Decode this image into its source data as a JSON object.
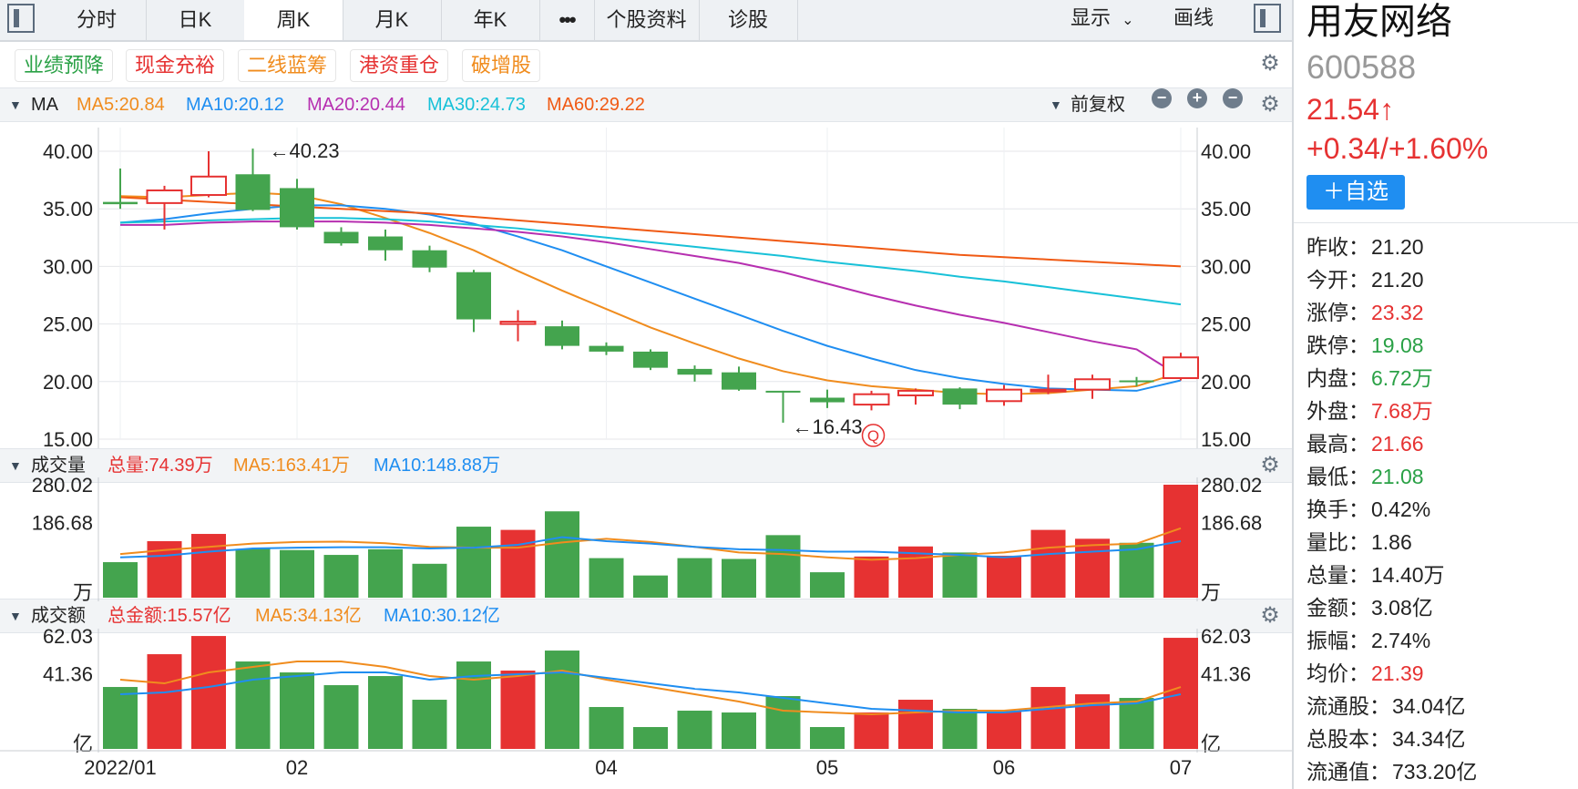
{
  "toolbar": {
    "tabs": [
      "分时",
      "日K",
      "周K",
      "月K",
      "年K",
      "•••",
      "个股资料",
      "诊股"
    ],
    "active_tab": "周K",
    "display_label": "显示",
    "draw_label": "画线"
  },
  "tags": [
    {
      "label": "业绩预降",
      "color": "#2aa146"
    },
    {
      "label": "现金充裕",
      "color": "#e63232"
    },
    {
      "label": "二线蓝筹",
      "color": "#f08c1e"
    },
    {
      "label": "港资重仓",
      "color": "#e63232"
    },
    {
      "label": "破增股",
      "color": "#f08c1e"
    }
  ],
  "ma_bar": {
    "label": "MA",
    "items": [
      {
        "text": "MA5:20.84",
        "color": "#f08c1e"
      },
      {
        "text": "MA10:20.12",
        "color": "#1f8ef1"
      },
      {
        "text": "MA20:20.44",
        "color": "#b62fb0"
      },
      {
        "text": "MA30:24.73",
        "color": "#18c1d8"
      },
      {
        "text": "MA60:29.22",
        "color": "#f05a14"
      }
    ],
    "adjust_label": "前复权"
  },
  "volume_bar": {
    "label": "成交量",
    "items": [
      {
        "text": "总量:74.39万",
        "color": "#e63232"
      },
      {
        "text": "MA5:163.41万",
        "color": "#f08c1e"
      },
      {
        "text": "MA10:148.88万",
        "color": "#1f8ef1"
      }
    ]
  },
  "amount_bar": {
    "label": "成交额",
    "items": [
      {
        "text": "总金额:15.57亿",
        "color": "#e63232"
      },
      {
        "text": "MA5:34.13亿",
        "color": "#f08c1e"
      },
      {
        "text": "MA10:30.12亿",
        "color": "#1f8ef1"
      }
    ]
  },
  "quote": {
    "name": "用友网络",
    "code": "600588",
    "price": "21.54↑",
    "change": "+0.34/+1.60%",
    "add_button": "＋自选",
    "rows": [
      {
        "label": "昨收：",
        "value": "21.20",
        "color": "black"
      },
      {
        "label": "今开：",
        "value": "21.20",
        "color": "black"
      },
      {
        "label": "涨停：",
        "value": "23.32",
        "color": "red"
      },
      {
        "label": "跌停：",
        "value": "19.08",
        "color": "green"
      },
      {
        "label": "内盘：",
        "value": "6.72万",
        "color": "green"
      },
      {
        "label": "外盘：",
        "value": "7.68万",
        "color": "red"
      },
      {
        "label": "最高：",
        "value": "21.66",
        "color": "red"
      },
      {
        "label": "最低：",
        "value": "21.08",
        "color": "green"
      },
      {
        "label": "换手：",
        "value": "0.42%",
        "color": "black"
      },
      {
        "label": "量比：",
        "value": "1.86",
        "color": "black"
      },
      {
        "label": "总量：",
        "value": "14.40万",
        "color": "black"
      },
      {
        "label": "金额：",
        "value": "3.08亿",
        "color": "black"
      },
      {
        "label": "振幅：",
        "value": "2.74%",
        "color": "black"
      },
      {
        "label": "均价：",
        "value": "21.39",
        "color": "red"
      },
      {
        "label": "流通股：",
        "value": "34.04亿",
        "color": "black"
      },
      {
        "label": "总股本：",
        "value": "34.34亿",
        "color": "black"
      },
      {
        "label": "流通值：",
        "value": "733.20亿",
        "color": "black"
      }
    ]
  },
  "chart_data": {
    "type": "candlestick",
    "price_axis": {
      "ticks": [
        "40.00",
        "35.00",
        "30.00",
        "25.00",
        "20.00",
        "15.00"
      ],
      "ylim": [
        15,
        40
      ]
    },
    "x_tick_labels": [
      "2022/01",
      "02",
      "04",
      "05",
      "06",
      "07"
    ],
    "annotations": {
      "high_label": "←40.23",
      "low_label": "←16.43",
      "marker": "Q"
    },
    "candles": [
      {
        "o": 35.6,
        "h": 38.5,
        "l": 35.0,
        "c": 35.4
      },
      {
        "o": 35.5,
        "h": 37.0,
        "l": 33.2,
        "c": 36.6
      },
      {
        "o": 36.2,
        "h": 40.0,
        "l": 36.0,
        "c": 37.8
      },
      {
        "o": 38.0,
        "h": 40.23,
        "l": 34.8,
        "c": 34.9
      },
      {
        "o": 36.8,
        "h": 37.6,
        "l": 33.2,
        "c": 33.4
      },
      {
        "o": 33.0,
        "h": 33.4,
        "l": 31.8,
        "c": 32.0
      },
      {
        "o": 32.6,
        "h": 33.2,
        "l": 30.5,
        "c": 31.4
      },
      {
        "o": 31.4,
        "h": 31.8,
        "l": 29.5,
        "c": 29.9
      },
      {
        "o": 29.5,
        "h": 29.7,
        "l": 24.3,
        "c": 25.4
      },
      {
        "o": 25.0,
        "h": 26.2,
        "l": 23.5,
        "c": 25.2
      },
      {
        "o": 24.8,
        "h": 25.3,
        "l": 22.8,
        "c": 23.1
      },
      {
        "o": 23.1,
        "h": 23.4,
        "l": 22.3,
        "c": 22.6
      },
      {
        "o": 22.6,
        "h": 22.8,
        "l": 21.0,
        "c": 21.2
      },
      {
        "o": 21.1,
        "h": 21.4,
        "l": 20.0,
        "c": 20.6
      },
      {
        "o": 20.8,
        "h": 21.3,
        "l": 19.2,
        "c": 19.3
      },
      {
        "o": 19.2,
        "h": 19.2,
        "l": 16.43,
        "c": 19.1
      },
      {
        "o": 18.6,
        "h": 19.3,
        "l": 17.7,
        "c": 18.2
      },
      {
        "o": 18.0,
        "h": 19.2,
        "l": 17.5,
        "c": 18.9
      },
      {
        "o": 18.8,
        "h": 19.4,
        "l": 18.0,
        "c": 19.2
      },
      {
        "o": 19.4,
        "h": 19.5,
        "l": 17.6,
        "c": 18.0
      },
      {
        "o": 18.3,
        "h": 19.7,
        "l": 17.9,
        "c": 19.3
      },
      {
        "o": 19.2,
        "h": 20.6,
        "l": 18.9,
        "c": 19.3
      },
      {
        "o": 19.3,
        "h": 20.6,
        "l": 18.5,
        "c": 20.2
      },
      {
        "o": 20.1,
        "h": 20.4,
        "l": 19.6,
        "c": 20.0
      },
      {
        "o": 20.3,
        "h": 22.5,
        "l": 20.1,
        "c": 22.1
      }
    ],
    "ma_lines": [
      {
        "name": "MA5",
        "color": "#f08c1e",
        "values": [
          36.1,
          36.0,
          36.2,
          36.4,
          36.2,
          35.4,
          34.2,
          32.9,
          31.4,
          29.6,
          27.9,
          26.3,
          24.7,
          23.3,
          22.0,
          20.9,
          20.1,
          19.6,
          19.3,
          19.0,
          18.9,
          19.0,
          19.3,
          19.6,
          20.8
        ]
      },
      {
        "name": "MA10",
        "color": "#1f8ef1",
        "values": [
          33.8,
          34.1,
          34.6,
          35.0,
          35.3,
          35.3,
          35.0,
          34.5,
          33.7,
          32.6,
          31.4,
          30.0,
          28.6,
          27.2,
          25.8,
          24.4,
          23.1,
          22.0,
          21.0,
          20.3,
          19.8,
          19.4,
          19.3,
          19.2,
          20.1
        ]
      },
      {
        "name": "MA20",
        "color": "#b62fb0",
        "values": [
          33.6,
          33.6,
          33.8,
          33.9,
          33.9,
          33.9,
          33.8,
          33.6,
          33.3,
          33.0,
          32.6,
          32.1,
          31.5,
          30.9,
          30.3,
          29.5,
          28.5,
          27.5,
          26.6,
          25.8,
          25.1,
          24.3,
          23.5,
          22.8,
          20.4
        ]
      },
      {
        "name": "MA30",
        "color": "#18c1d8",
        "values": [
          33.8,
          33.9,
          34.0,
          34.1,
          34.2,
          34.2,
          34.1,
          33.9,
          33.6,
          33.3,
          32.9,
          32.5,
          32.1,
          31.7,
          31.3,
          30.9,
          30.4,
          30.0,
          29.6,
          29.1,
          28.7,
          28.2,
          27.7,
          27.2,
          26.7
        ]
      },
      {
        "name": "MA60",
        "color": "#f05a14",
        "values": [
          36.0,
          35.8,
          35.6,
          35.4,
          35.2,
          35.0,
          34.8,
          34.6,
          34.3,
          34.0,
          33.7,
          33.4,
          33.1,
          32.8,
          32.5,
          32.2,
          31.9,
          31.6,
          31.3,
          31.0,
          30.8,
          30.6,
          30.4,
          30.2,
          30.0
        ]
      }
    ],
    "volume": {
      "ticks": [
        "280.02",
        "186.68"
      ],
      "unit": "万",
      "ylim": [
        0,
        280.02
      ],
      "values": [
        88,
        140,
        158,
        121,
        118,
        106,
        120,
        84,
        176,
        168,
        214,
        98,
        55,
        98,
        96,
        155,
        63,
        102,
        127,
        112,
        104,
        168,
        146,
        136,
        280
      ],
      "ma5": [
        108,
        118,
        126,
        134,
        138,
        139,
        135,
        126,
        124,
        124,
        137,
        146,
        138,
        126,
        112,
        108,
        100,
        94,
        98,
        106,
        112,
        124,
        130,
        134,
        172
      ],
      "ma10": [
        100,
        104,
        114,
        122,
        124,
        125,
        125,
        122,
        124,
        131,
        150,
        140,
        134,
        126,
        120,
        118,
        114,
        114,
        110,
        106,
        100,
        108,
        114,
        120,
        140
      ]
    },
    "amount": {
      "ticks": [
        "62.03",
        "41.36"
      ],
      "unit": "亿",
      "ylim": [
        0,
        62.03
      ],
      "values": [
        34,
        52,
        62,
        48,
        42,
        35,
        40,
        27,
        48,
        43,
        54,
        23,
        12,
        21,
        20,
        29,
        12,
        20,
        27,
        22,
        21,
        34,
        30,
        28,
        61
      ],
      "ma5": [
        38,
        36,
        42,
        45,
        48,
        48,
        45,
        40,
        38,
        40,
        43,
        38,
        34,
        30,
        26,
        21,
        20,
        19,
        20,
        21,
        21,
        23,
        25,
        26,
        34
      ],
      "ma10": [
        30,
        31,
        34,
        38,
        40,
        42,
        42,
        38,
        40,
        41,
        42,
        39,
        36,
        33,
        31,
        28,
        25,
        22,
        21,
        20,
        20,
        22,
        24,
        25,
        30
      ]
    }
  }
}
